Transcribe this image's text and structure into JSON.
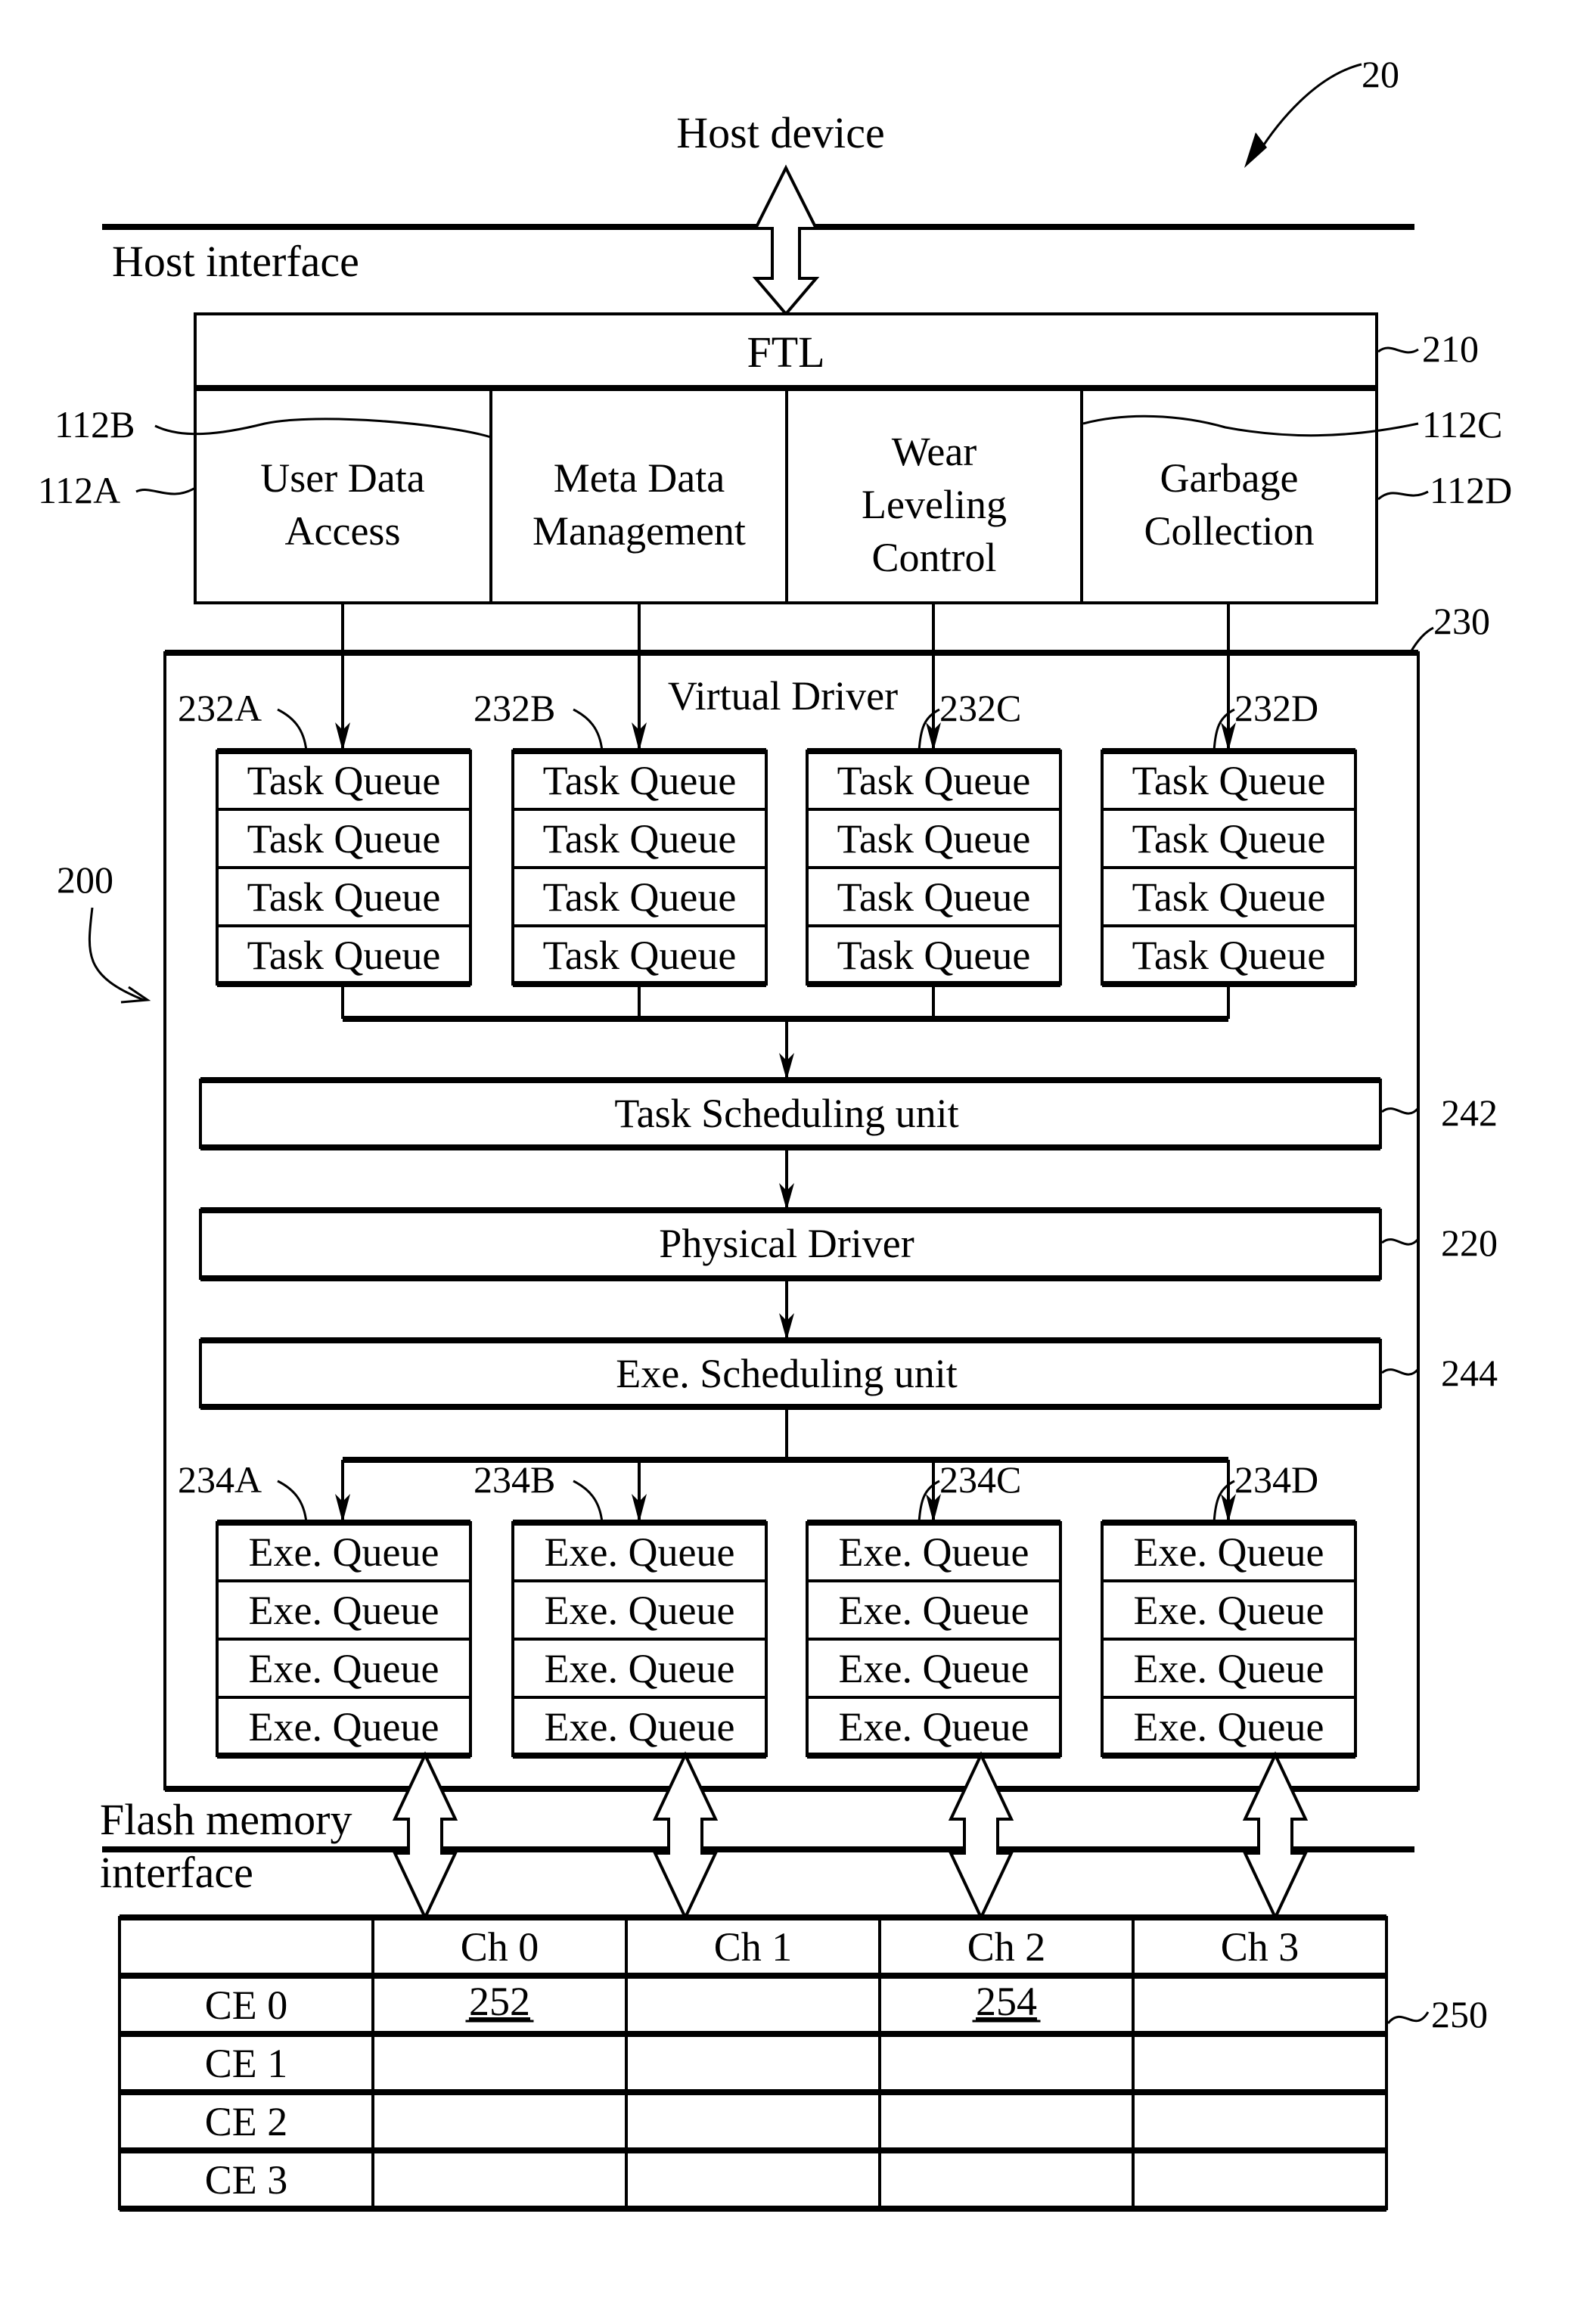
{
  "figure": {
    "ref": "20",
    "host_device": "Host device",
    "host_interface": "Host interface",
    "flash_interface_line1": "Flash memory",
    "flash_interface_line2": "interface"
  },
  "ftl": {
    "label": "FTL",
    "ref": "210",
    "modules": [
      {
        "ref": "112A",
        "lines": [
          "User Data",
          "Access"
        ]
      },
      {
        "ref": "112B",
        "lines": [
          "Meta Data",
          "Management"
        ]
      },
      {
        "ref": "112C",
        "lines": [
          "Wear",
          "Leveling",
          "Control"
        ]
      },
      {
        "ref": "112D",
        "lines": [
          "Garbage",
          "Collection"
        ]
      }
    ]
  },
  "controller": {
    "ref": "200"
  },
  "virtual_driver": {
    "label": "Virtual Driver",
    "ref": "230",
    "task_queue_groups": [
      {
        "ref": "232A",
        "items": [
          "Task Queue",
          "Task Queue",
          "Task Queue",
          "Task Queue"
        ]
      },
      {
        "ref": "232B",
        "items": [
          "Task Queue",
          "Task Queue",
          "Task Queue",
          "Task Queue"
        ]
      },
      {
        "ref": "232C",
        "items": [
          "Task Queue",
          "Task Queue",
          "Task Queue",
          "Task Queue"
        ]
      },
      {
        "ref": "232D",
        "items": [
          "Task Queue",
          "Task Queue",
          "Task Queue",
          "Task Queue"
        ]
      }
    ],
    "task_scheduling": {
      "label": "Task Scheduling unit",
      "ref": "242"
    },
    "physical_driver": {
      "label": "Physical Driver",
      "ref": "220"
    },
    "exe_scheduling": {
      "label": "Exe. Scheduling unit",
      "ref": "244"
    },
    "exe_queue_groups": [
      {
        "ref": "234A",
        "items": [
          "Exe. Queue",
          "Exe. Queue",
          "Exe. Queue",
          "Exe. Queue"
        ]
      },
      {
        "ref": "234B",
        "items": [
          "Exe. Queue",
          "Exe. Queue",
          "Exe. Queue",
          "Exe. Queue"
        ]
      },
      {
        "ref": "234C",
        "items": [
          "Exe. Queue",
          "Exe. Queue",
          "Exe. Queue",
          "Exe. Queue"
        ]
      },
      {
        "ref": "234D",
        "items": [
          "Exe. Queue",
          "Exe. Queue",
          "Exe. Queue",
          "Exe. Queue"
        ]
      }
    ]
  },
  "flash_array": {
    "ref": "250",
    "columns": [
      "",
      "Ch 0",
      "Ch 1",
      "Ch 2",
      "Ch 3"
    ],
    "rows": [
      {
        "label": "CE 0",
        "cells": [
          "252",
          "",
          "254",
          ""
        ]
      },
      {
        "label": "CE 1",
        "cells": [
          "",
          "",
          "",
          ""
        ]
      },
      {
        "label": "CE 2",
        "cells": [
          "",
          "",
          "",
          ""
        ]
      },
      {
        "label": "CE 3",
        "cells": [
          "",
          "",
          "",
          ""
        ]
      }
    ],
    "underlined_cells": [
      "252",
      "254"
    ]
  }
}
